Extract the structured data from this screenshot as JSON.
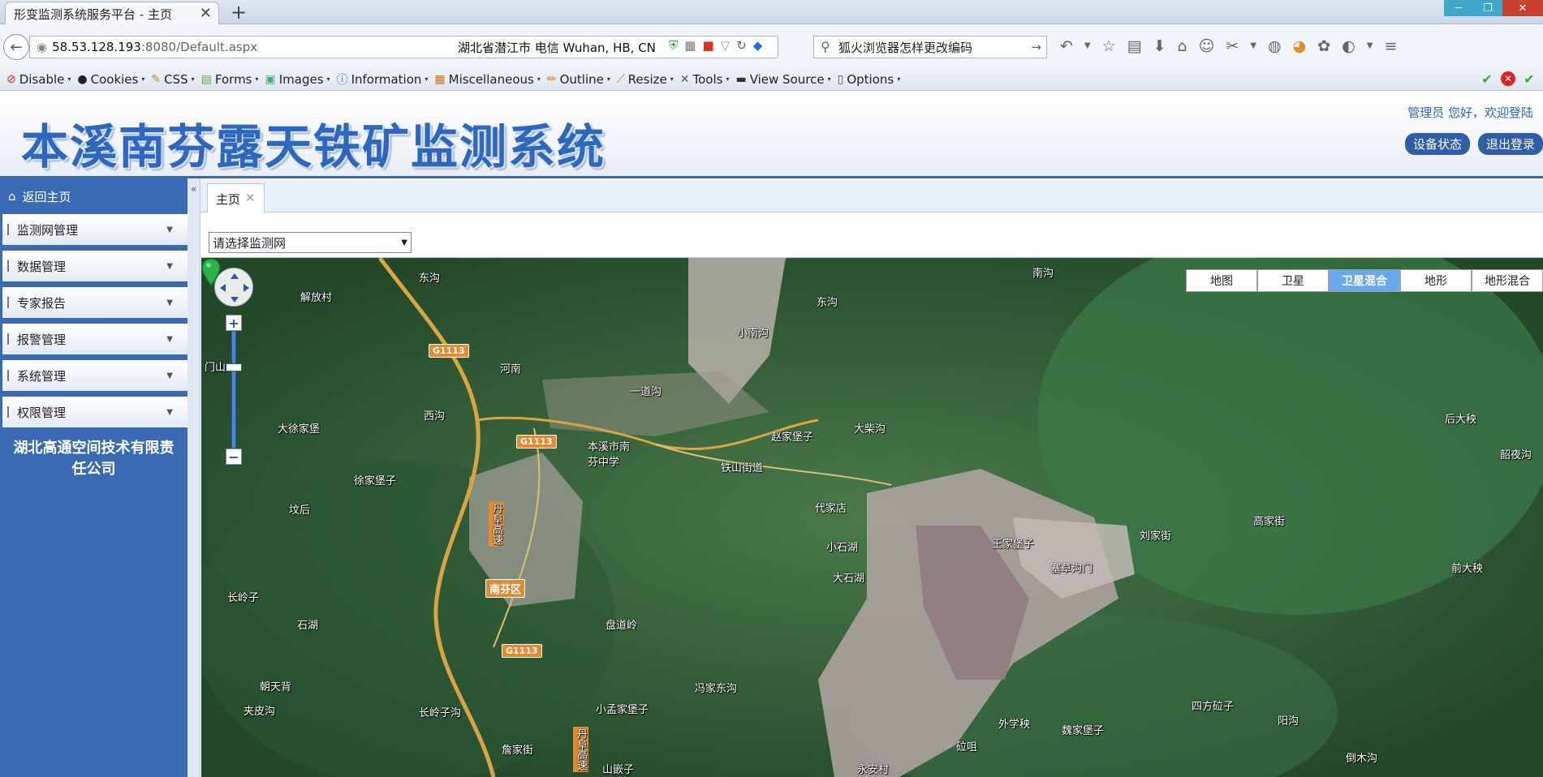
{
  "browser": {
    "tab_title": "形变监测系统服务平台 - 主页",
    "url_host": "58.53.128.193",
    "url_rest": ":8080/Default.aspx",
    "geo_info": "湖北省潜江市 电信    Wuhan, HB, CN",
    "search_value": "狐火浏览器怎样更改编码"
  },
  "toolbar": {
    "items": [
      "Disable",
      "Cookies",
      "CSS",
      "Forms",
      "Images",
      "Information",
      "Miscellaneous",
      "Outline",
      "Resize",
      "Tools",
      "View Source",
      "Options"
    ]
  },
  "header": {
    "title": "本溪南芬露天铁矿监测系统",
    "greeting": "管理员  您好，欢迎登陆",
    "device_status_label": "设备状态",
    "logout_label": "退出登录"
  },
  "sidebar": {
    "home_label": "返回主页",
    "items": [
      {
        "label": "监测网管理"
      },
      {
        "label": "数据管理"
      },
      {
        "label": "专家报告"
      },
      {
        "label": "报警管理"
      },
      {
        "label": "系统管理"
      },
      {
        "label": "权限管理"
      }
    ],
    "company": "湖北高通空间技术有限责任公司"
  },
  "content": {
    "tab_label": "主页",
    "select_placeholder": "请选择监测网"
  },
  "map": {
    "types": [
      {
        "label": "地图",
        "active": false
      },
      {
        "label": "卫星",
        "active": false
      },
      {
        "label": "卫星混合",
        "active": true
      },
      {
        "label": "地形",
        "active": false
      },
      {
        "label": "地形混合",
        "active": false
      }
    ],
    "road_shields": [
      "G1113",
      "G1113",
      "G1113"
    ],
    "district": "南芬区",
    "highway_name": "丹阜高速",
    "highway_name_2": "丹阜高速",
    "places": [
      "东沟",
      "解放村",
      "河南",
      "一道沟",
      "小南沟",
      "东沟",
      "南沟",
      "西沟",
      "大徐家堡",
      "本溪市南芬中学",
      "铁山街道",
      "赵家堡子",
      "大柴沟",
      "徐家堡子",
      "坟后",
      "代家店",
      "小石湖",
      "大石湖",
      "王家堡子",
      "塞草沟门",
      "刘家街",
      "高家街",
      "长岭子",
      "石湖",
      "盘道岭",
      "朝天背",
      "夹皮沟",
      "长岭子沟",
      "小孟家堡子",
      "冯家东沟",
      "詹家街",
      "山嵌子",
      "外学秧",
      "魏家堡子",
      "四方砬子",
      "阳沟",
      "倒木沟",
      "后大秧",
      "韶夜沟",
      "前大秧",
      "永安村",
      "砬咀",
      "门山"
    ]
  }
}
